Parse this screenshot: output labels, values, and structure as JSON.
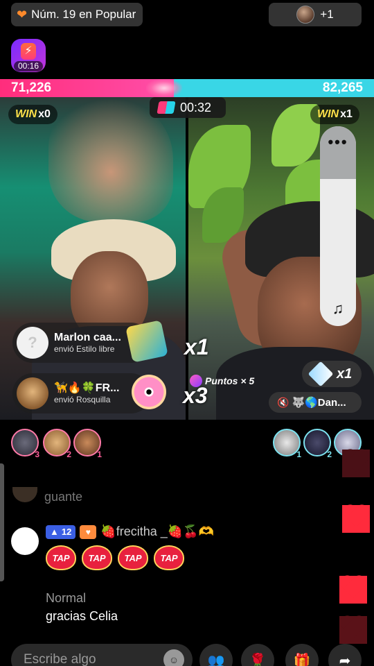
{
  "top_bar": {
    "rank_text": "Núm. 19 en Popular",
    "viewers_text": "+1"
  },
  "boost": {
    "timer": "00:16"
  },
  "battle": {
    "score_left": "71,226",
    "score_right": "82,265",
    "left_share": 0.464,
    "timer": "00:32",
    "win_left": {
      "label": "WIN",
      "count": "x0"
    },
    "win_right": {
      "label": "WIN",
      "count": "x1"
    }
  },
  "gifts": [
    {
      "name": "Marlon caa...",
      "subtitle": "envió Estilo libre",
      "combo": "x1",
      "avatar_glyph": "?"
    },
    {
      "name": "🦮🔥🍀FR...",
      "subtitle": "envió Rosquilla",
      "combo": "x3"
    }
  ],
  "puntos": {
    "label": "Puntos × 5"
  },
  "right_pills": {
    "combo": "x1",
    "mute_name": "🐺🌎Dan..."
  },
  "rankers_left": [
    {
      "rank": "3"
    },
    {
      "rank": "2"
    },
    {
      "rank": "1"
    }
  ],
  "rankers_right": [
    {
      "rank": "1"
    },
    {
      "rank": "2"
    },
    {
      "rank": "3"
    }
  ],
  "chat": {
    "cut_text": "guante",
    "user": {
      "level": "12",
      "name": "🍓frecitha _🍓🍒🫶"
    },
    "taps": [
      "TAP",
      "TAP",
      "TAP",
      "TAP"
    ],
    "message_label": "Normal",
    "message_text": "gracias Celia"
  },
  "comment": {
    "placeholder": "Escribe algo"
  },
  "colors": {
    "accent_pink": "#ff2d7c",
    "accent_cyan": "#39d6e6",
    "heart_red": "#ff2b3c"
  },
  "icons": [
    "orange-heart-icon",
    "bolt-icon",
    "vs-icon",
    "more-dots-icon",
    "music-note-icon",
    "sword-icon",
    "mute-icon",
    "emoji-icon",
    "people-icon",
    "rose-icon",
    "gift-icon",
    "share-icon"
  ]
}
